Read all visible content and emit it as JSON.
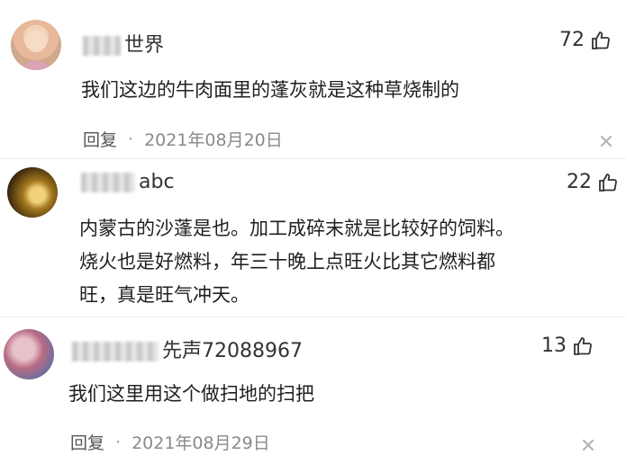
{
  "comments": [
    {
      "username_visible": "世界",
      "likes": "72",
      "text": "我们这边的牛肉面里的蓬灰就是这种草烧制的",
      "reply_label": "回复",
      "date": "2021年08月20日"
    },
    {
      "username_visible": "abc",
      "likes": "22",
      "text_lines": [
        "内蒙古的沙蓬是也。加工成碎末就是比较好的饲料。",
        "烧火也是好燃料，年三十晚上点旺火比其它燃料都",
        "旺，真是旺气冲天。"
      ]
    },
    {
      "username_visible": "先声72088967",
      "likes": "13",
      "text": "我们这里用这个做扫地的扫把",
      "reply_label": "回复",
      "date": "2021年08月29日"
    }
  ],
  "colors": {
    "text": "#1f1f1f",
    "meta": "#8a8a8a"
  },
  "icons": {
    "like": "thumbs-up-icon",
    "close": "close-icon"
  }
}
